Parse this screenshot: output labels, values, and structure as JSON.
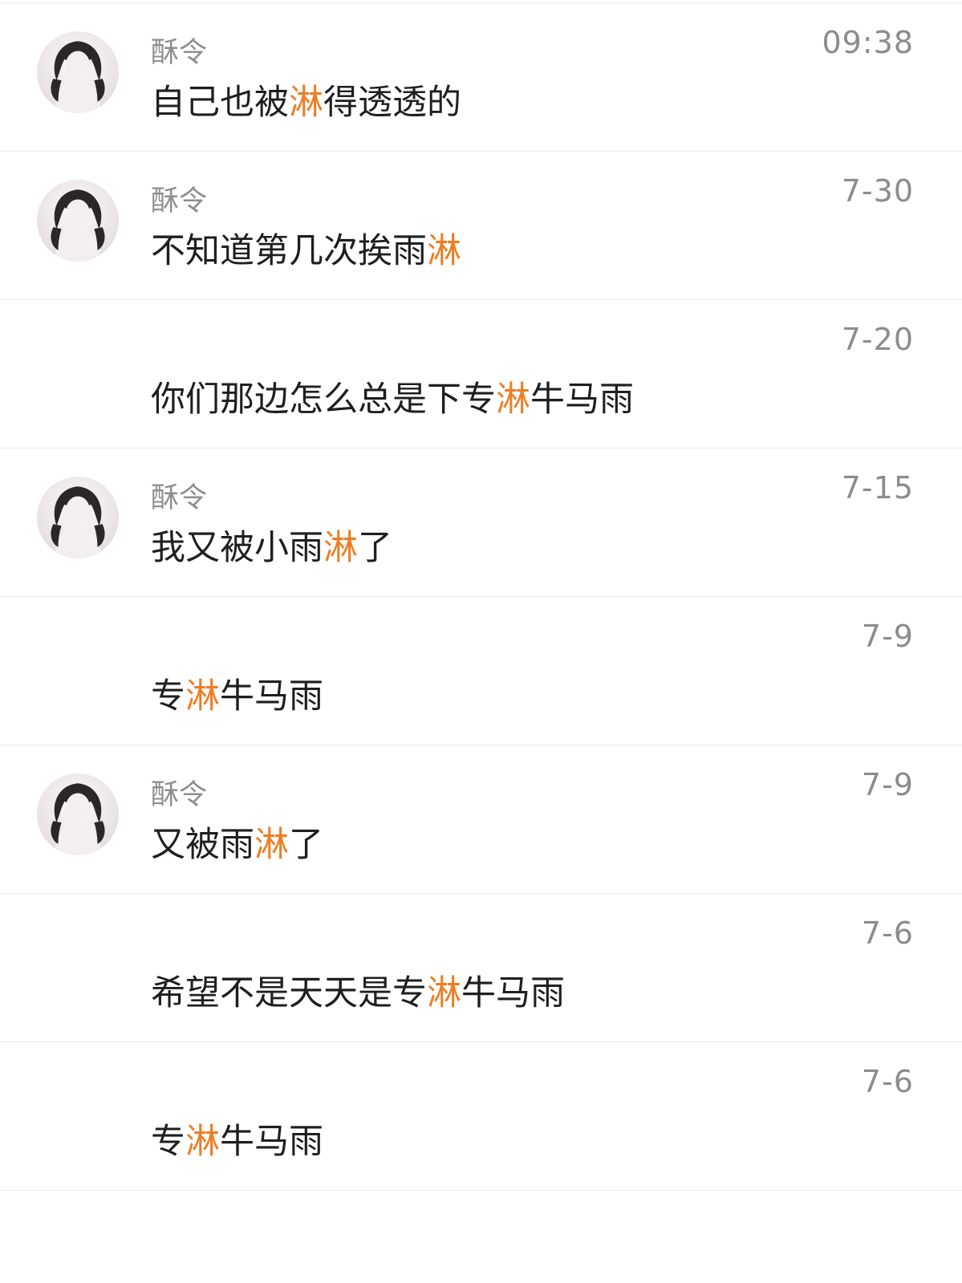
{
  "colors": {
    "highlight": "#ef7d22",
    "text": "#1f1f1f",
    "meta": "#8c8c8c",
    "divider": "#ececec"
  },
  "messages": [
    {
      "has_avatar": true,
      "name": "酥令",
      "time": "09:38",
      "pre": "自己也被",
      "hl": "淋",
      "post": "得透透的"
    },
    {
      "has_avatar": true,
      "name": "酥令",
      "time": "7-30",
      "pre": "不知道第几次挨雨",
      "hl": "淋",
      "post": ""
    },
    {
      "has_avatar": false,
      "name": "",
      "time": "7-20",
      "pre": "你们那边怎么总是下专",
      "hl": "淋",
      "post": "牛马雨"
    },
    {
      "has_avatar": true,
      "name": "酥令",
      "time": "7-15",
      "pre": "我又被小雨",
      "hl": "淋",
      "post": "了"
    },
    {
      "has_avatar": false,
      "name": "",
      "time": "7-9",
      "pre": "专",
      "hl": "淋",
      "post": "牛马雨"
    },
    {
      "has_avatar": true,
      "name": "酥令",
      "time": "7-9",
      "pre": "又被雨",
      "hl": "淋",
      "post": "了"
    },
    {
      "has_avatar": false,
      "name": "",
      "time": "7-6",
      "pre": "希望不是天天是专",
      "hl": "淋",
      "post": "牛马雨"
    },
    {
      "has_avatar": false,
      "name": "",
      "time": "7-6",
      "pre": "专",
      "hl": "淋",
      "post": "牛马雨"
    }
  ]
}
